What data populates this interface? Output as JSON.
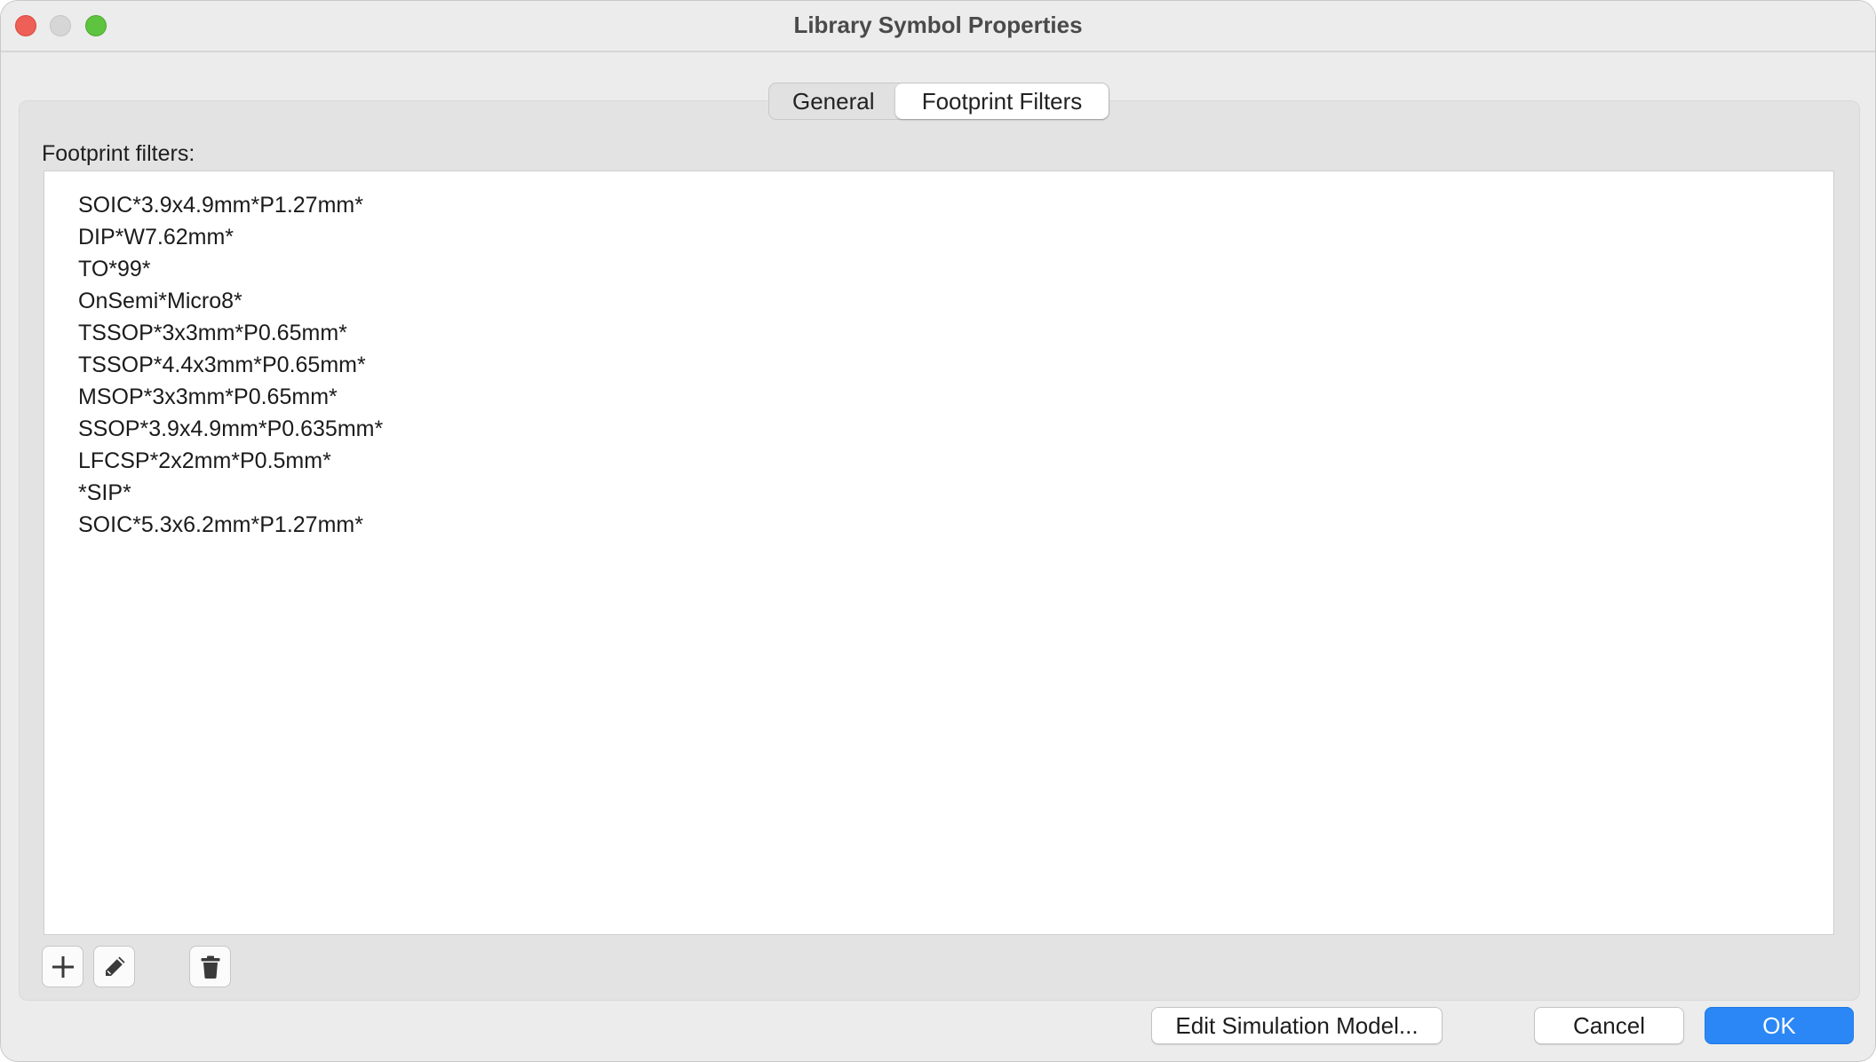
{
  "window": {
    "title": "Library Symbol Properties"
  },
  "tabs": [
    {
      "label": "General",
      "active": false
    },
    {
      "label": "Footprint Filters",
      "active": true
    }
  ],
  "footprint_filters": {
    "label": "Footprint filters:",
    "items": [
      "SOIC*3.9x4.9mm*P1.27mm*",
      "DIP*W7.62mm*",
      "TO*99*",
      "OnSemi*Micro8*",
      "TSSOP*3x3mm*P0.65mm*",
      "TSSOP*4.4x3mm*P0.65mm*",
      "MSOP*3x3mm*P0.65mm*",
      "SSOP*3.9x4.9mm*P0.635mm*",
      "LFCSP*2x2mm*P0.5mm*",
      "*SIP*",
      "SOIC*5.3x6.2mm*P1.27mm*"
    ]
  },
  "toolbar": {
    "add_icon": "plus-icon",
    "edit_icon": "pencil-icon",
    "delete_icon": "trash-icon"
  },
  "buttons": {
    "edit_simulation_model": "Edit Simulation Model...",
    "cancel": "Cancel",
    "ok": "OK"
  },
  "colors": {
    "accent": "#2b87f5",
    "close": "#ee5f58",
    "minimize": "#d6d6d6",
    "maximize": "#5ec33f"
  }
}
